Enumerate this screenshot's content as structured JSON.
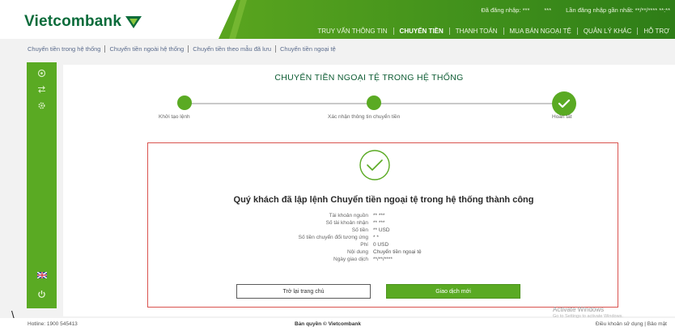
{
  "brand": {
    "name": "Vietcombank",
    "colors": {
      "primary_green": "#5aaa23",
      "dark_green": "#0a6b3a",
      "highlight_red": "#d9534f"
    }
  },
  "header": {
    "topline": [
      "Đã đăng nhập: ***",
      "***",
      "Lần đăng nhập gần nhất: **/**/**** **:**"
    ],
    "nav": [
      {
        "label": "TRUY VẤN THÔNG TIN",
        "active": false
      },
      {
        "label": "CHUYỂN TIỀN",
        "active": true
      },
      {
        "label": "THANH TOÁN",
        "active": false
      },
      {
        "label": "MUA BÁN NGOẠI TỆ",
        "active": false
      },
      {
        "label": "QUẢN LÝ KHÁC",
        "active": false
      },
      {
        "label": "HỖ TRỢ",
        "active": false
      }
    ]
  },
  "subnav": [
    "Chuyển tiền trong hệ thống",
    "Chuyển tiền ngoài hệ thống",
    "Chuyển tiền theo mẫu đã lưu",
    "Chuyển tiền ngoại tệ"
  ],
  "rail_icons": [
    "home-icon",
    "transfer-icon",
    "settings-icon",
    "flag-uk-icon",
    "power-icon"
  ],
  "page": {
    "title": "CHUYỂN TIỀN NGOẠI TỆ TRONG HỆ THỐNG",
    "steps": [
      {
        "label": "Khởi tạo lệnh",
        "state": "done"
      },
      {
        "label": "Xác nhận thông tin chuyển tiền",
        "state": "done"
      },
      {
        "label": "Hoàn tất",
        "state": "current"
      }
    ]
  },
  "result": {
    "message": "Quý khách đã lập lệnh Chuyển tiền ngoại tệ trong hệ thống thành công",
    "details": [
      {
        "label": "Tài khoản nguồn",
        "value": "**          ***"
      },
      {
        "label": "Số tài khoản nhận",
        "value": "**         ***"
      },
      {
        "label": "Số tiền",
        "value": "** USD"
      },
      {
        "label": "Số tiền chuyển đổi tương ứng",
        "value": "*        *"
      },
      {
        "label": "Phí",
        "value": "0 USD"
      },
      {
        "label": "Nội dung",
        "value": "Chuyển tiền ngoại tệ"
      },
      {
        "label": "Ngày giao dịch",
        "value": "**/**/****"
      }
    ],
    "buttons": {
      "home": "Trở lại trang chủ",
      "new": "Giao dịch mới"
    }
  },
  "footer": {
    "left": "Hotline: 1900 545413",
    "center": "Bản quyền © Vietcombank",
    "right": "Điều khoản sử dụng | Bảo mật"
  },
  "watermark": {
    "title": "Activate Windows",
    "subtitle": "Go to Settings to activate Windows."
  },
  "stray_text": "\\"
}
